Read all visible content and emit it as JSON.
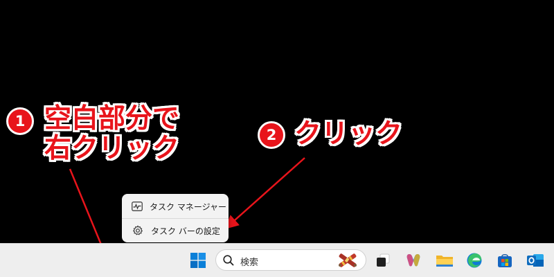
{
  "annotations": [
    {
      "badge": "1",
      "lines": [
        "空白部分で",
        "右クリック"
      ]
    },
    {
      "badge": "2",
      "lines": [
        "クリック"
      ]
    }
  ],
  "context_menu": {
    "items": [
      {
        "label": "タスク マネージャー",
        "icon": "task-manager-icon"
      },
      {
        "label": "タスク バーの設定",
        "icon": "gear-icon"
      }
    ]
  },
  "taskbar": {
    "search": {
      "label": "検索",
      "icon": "search-icon"
    },
    "icons": [
      "windows-start-icon",
      "task-view-icon",
      "copilot-icon",
      "file-explorer-icon",
      "edge-icon",
      "microsoft-store-icon",
      "outlook-icon"
    ]
  },
  "colors": {
    "annotation_red": "#e8141b",
    "taskbar": "#eeeeee",
    "menu": "#f3f3f3",
    "background": "#000000"
  }
}
